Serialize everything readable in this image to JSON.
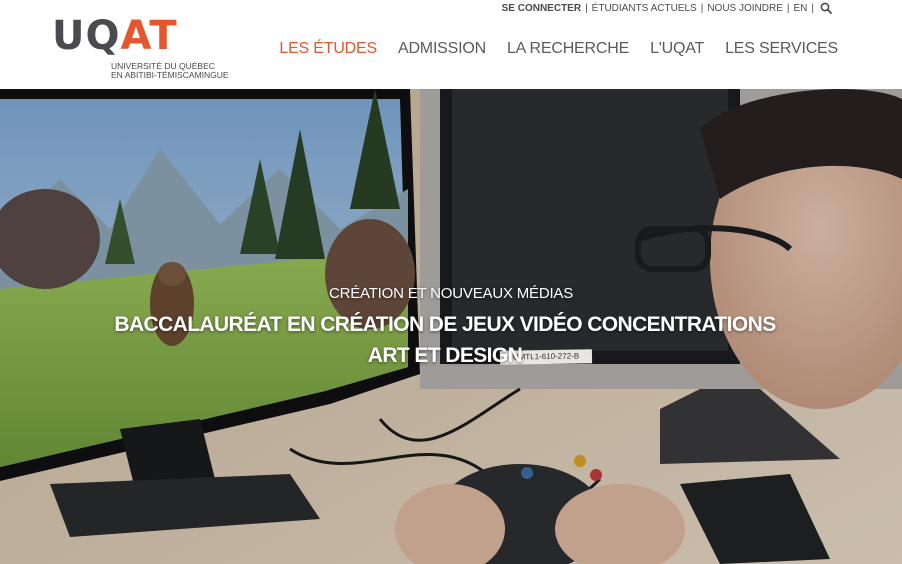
{
  "brand": {
    "logo_word_uq": "UQ",
    "logo_word_at": "AT",
    "subtitle_line1": "UNIVERSITÉ DU QUÉBEC",
    "subtitle_line2": "EN ABITIBI-TÉMISCAMINGUE",
    "colors": {
      "accent": "#e4572e",
      "gray": "#4a4b4e"
    }
  },
  "utility_nav": {
    "login": "SE CONNECTER",
    "current_students": "ÉTUDIANTS ACTUELS",
    "contact": "NOUS JOINDRE",
    "language": "EN",
    "search_icon": "search-icon"
  },
  "main_nav": [
    {
      "label": "LES ÉTUDES",
      "active": true
    },
    {
      "label": "ADMISSION",
      "active": false
    },
    {
      "label": "LA RECHERCHE",
      "active": false
    },
    {
      "label": "L'UQAT",
      "active": false
    },
    {
      "label": "LES SERVICES",
      "active": false
    }
  ],
  "hero": {
    "kicker": "CRÉATION ET NOUVEAUX MÉDIAS",
    "title": "BACCALAURÉAT EN CRÉATION DE JEUX VIDÉO CONCENTRATIONS ART ET DESIGN",
    "monitor_tag": "UMTL1-610-272-B"
  }
}
